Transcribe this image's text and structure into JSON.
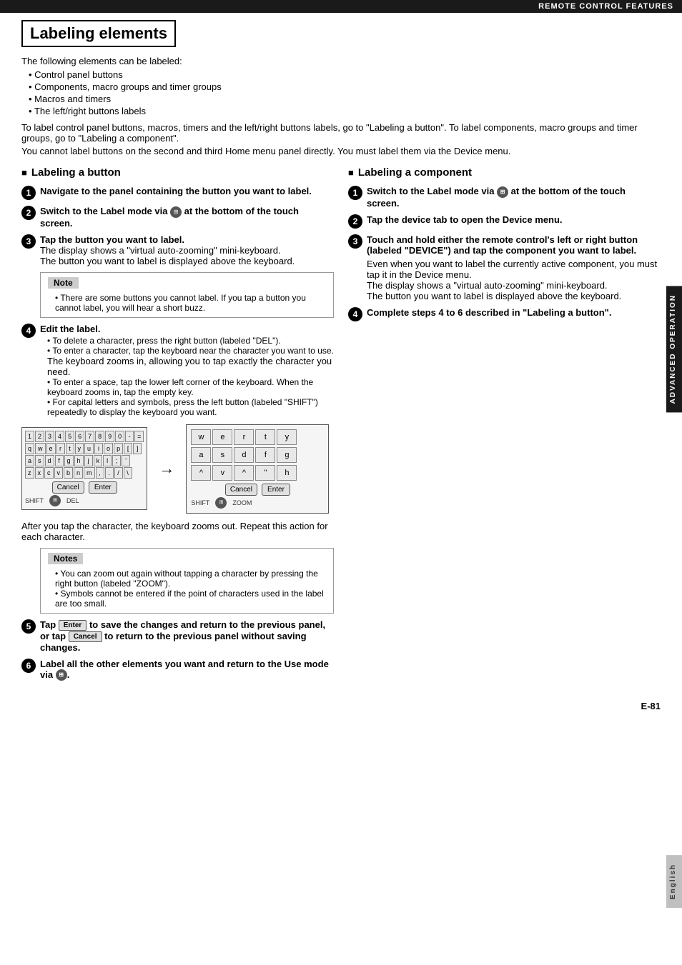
{
  "header": {
    "top_bar": "REMOTE CONTROL FEATURES"
  },
  "page": {
    "title": "Labeling elements",
    "intro": {
      "label": "The following elements can be labeled:",
      "bullets": [
        "Control panel buttons",
        "Components, macro groups and timer groups",
        "Macros and timers",
        "The left/right buttons labels"
      ],
      "para1": "To label control panel buttons, macros, timers and the left/right buttons labels, go to \"Labeling a button\". To label components, macro groups and timer groups, go to \"Labeling a component\".",
      "para2": "You cannot label buttons on the second and third Home menu panel directly. You must label them via the Device menu."
    }
  },
  "left_section": {
    "title": "Labeling a button",
    "steps": [
      {
        "num": "1",
        "bold": "Navigate to the panel containing the button you want to label."
      },
      {
        "num": "2",
        "bold": "Switch to the Label mode via",
        "icon": true,
        "bold2": "at the bottom of the touch screen."
      },
      {
        "num": "3",
        "bold": "Tap the button you want to label.",
        "normal": "The display shows a \"virtual auto-zooming\" mini-keyboard.\nThe button you want to label is displayed above the keyboard."
      }
    ],
    "note": {
      "title": "Note",
      "items": [
        "There are some buttons you cannot label. If you tap a button you cannot label, you will hear a short buzz."
      ]
    },
    "step4": {
      "num": "4",
      "bold": "Edit the label.",
      "bullets": [
        "To delete a character, press the right button (labeled \"DEL\").",
        "To enter a character, tap the keyboard near the character you want to use.",
        "To enter a space, tap the lower left corner of the keyboard. When the keyboard zooms in, tap the empty key.",
        "For capital letters and symbols, press the left button (labeled \"SHIFT\") repeatedly to display the keyboard you want."
      ],
      "sub_normal1": "The keyboard zooms in, allowing you to tap exactly the character you need."
    },
    "keyboard_small": {
      "rows": [
        [
          "1",
          "2",
          "3",
          "4",
          "5",
          "6",
          "7",
          "8",
          "9",
          "0",
          "-",
          "="
        ],
        [
          "q",
          "w",
          "e",
          "r",
          "t",
          "y",
          "u",
          "i",
          "o",
          "p",
          "[",
          "]"
        ],
        [
          "a",
          "s",
          "d",
          "f",
          "g",
          "h",
          "j",
          "k",
          "l",
          ";",
          "'"
        ],
        [
          "z",
          "x",
          "c",
          "v",
          "b",
          "n",
          "m",
          ",",
          ".",
          "/",
          "\\"
        ]
      ],
      "buttons": [
        "Cancel",
        "Enter"
      ],
      "footer": [
        "SHIFT",
        "DEL"
      ]
    },
    "keyboard_zoomed": {
      "rows": [
        [
          "w",
          "e",
          "r",
          "t",
          "y"
        ],
        [
          "a",
          "s",
          "d",
          "f",
          "g"
        ],
        [
          "^",
          "v",
          "^",
          "\"",
          "h"
        ]
      ],
      "buttons": [
        "Cancel",
        "Enter"
      ],
      "footer": [
        "SHIFT",
        "ZOOM"
      ]
    },
    "after_keyboard": "After you tap the character, the keyboard zooms out. Repeat this action for each character.",
    "notes2": {
      "title": "Notes",
      "items": [
        "You can zoom out again without tapping a character by pressing the right button (labeled \"ZOOM\").",
        "Symbols cannot be entered if the point of characters used in the label are too small."
      ]
    },
    "step5": {
      "num": "5",
      "text1": "Tap",
      "btn1": "Enter",
      "text2": "to save the changes and return to the previous panel, or tap",
      "btn2": "Cancel",
      "text3": "to return to the previous panel without saving changes."
    },
    "step6": {
      "num": "6",
      "text1": "Label all the other elements you want and return to the Use mode via",
      "icon": true,
      "text2": "."
    }
  },
  "right_section": {
    "title": "Labeling a component",
    "steps": [
      {
        "num": "1",
        "bold": "Switch to the Label mode via",
        "icon": true,
        "bold2": "at the bottom of the touch screen."
      },
      {
        "num": "2",
        "bold": "Tap the device tab to open the Device menu."
      },
      {
        "num": "3",
        "bold": "Touch and hold either the remote control's left or right button (labeled \"DEVICE\") and tap the component you want to label.",
        "normal1": "Even when you want to label the currently active component, you must tap it in the Device menu.",
        "normal2": "The display shows a \"virtual auto-zooming\" mini-keyboard.",
        "normal3": "The button you want to label is displayed above the keyboard."
      },
      {
        "num": "4",
        "bold": "Complete steps 4 to 6 described in \"Labeling a button\"."
      }
    ]
  },
  "side_tabs": {
    "advanced": "ADVANCED OPERATION",
    "english": "English"
  },
  "footer": {
    "page_num": "E-81"
  }
}
